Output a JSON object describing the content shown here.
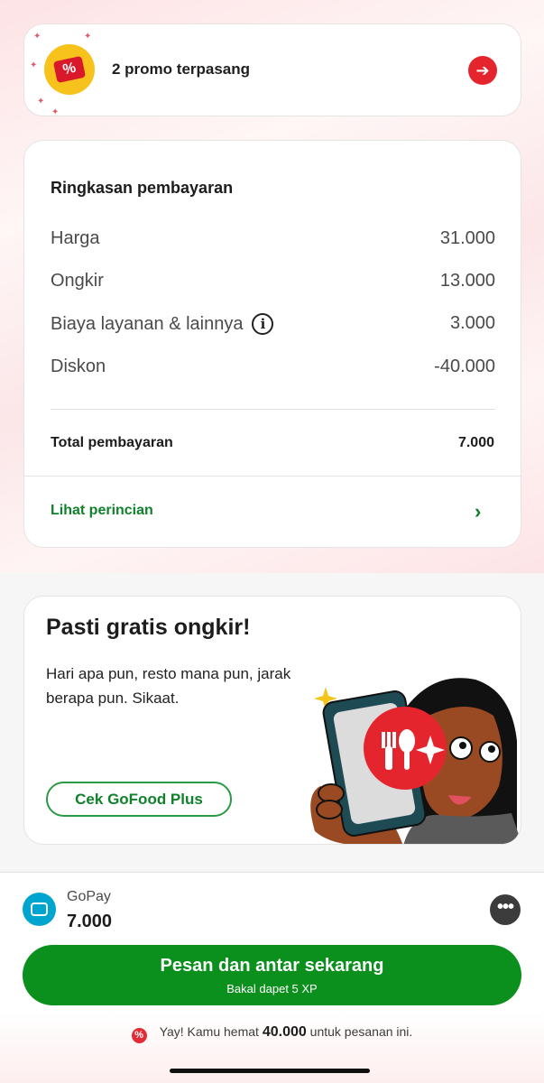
{
  "promo": {
    "text": "2 promo terpasang",
    "icon": "promo-ticket-icon",
    "arrow_icon": "arrow-right-icon"
  },
  "summary": {
    "title": "Ringkasan pembayaran",
    "rows": [
      {
        "label": "Harga",
        "value": "31.000"
      },
      {
        "label": "Ongkir",
        "value": "13.000"
      },
      {
        "label": "Biaya layanan & lainnya",
        "value": "3.000"
      },
      {
        "label": "Diskon",
        "value": "-40.000"
      }
    ],
    "info_glyph": "i",
    "total_label": "Total pembayaran",
    "total_value": "7.000",
    "detail_link": "Lihat perincian",
    "detail_chevron": "›"
  },
  "gofood_plus": {
    "title": "Pasti gratis ongkir!",
    "description": "Hari apa pun, resto mana pun, jarak berapa pun. Sikaat.",
    "button": "Cek GoFood Plus"
  },
  "payment": {
    "method": "GoPay",
    "amount": "7.000",
    "more_glyph": "•••"
  },
  "order_button": {
    "label": "Pesan dan antar sekarang",
    "sublabel": "Bakal dapet 5 XP"
  },
  "saving": {
    "prefix": "Yay! Kamu hemat",
    "amount": "40.000",
    "suffix": "untuk pesanan ini."
  },
  "colors": {
    "accent_green": "#0b8f1d",
    "link_green": "#10812b",
    "promo_red": "#e5252e",
    "gopay_blue": "#00a5cf"
  }
}
